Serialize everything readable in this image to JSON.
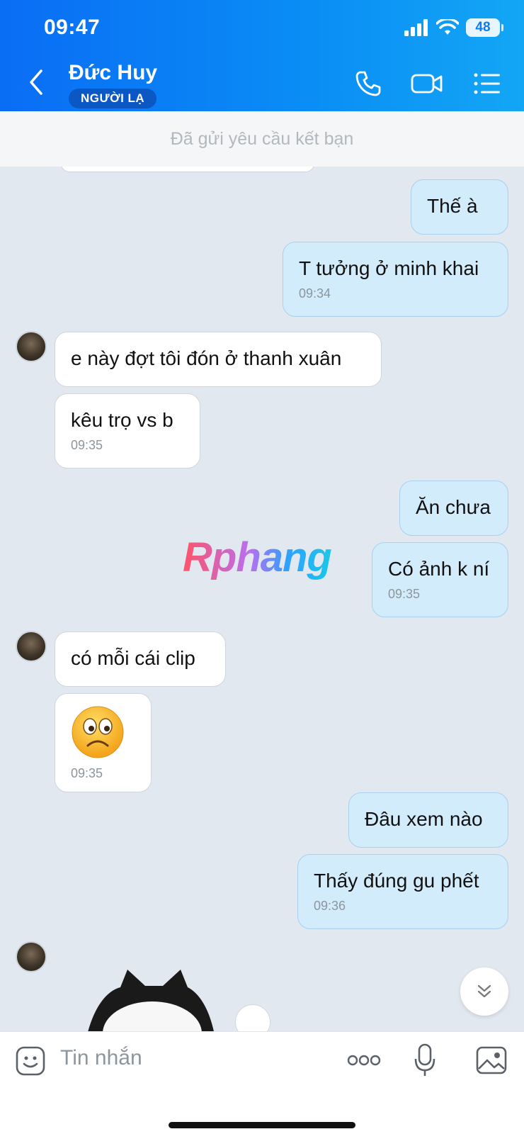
{
  "status_bar": {
    "time": "09:47",
    "battery": "48"
  },
  "header": {
    "contact_name": "Đức Huy",
    "badge": "NGƯỜI LẠ"
  },
  "friend_request": {
    "text": "Đã gửi yêu cầu kết bạn"
  },
  "messages": [
    {
      "from": "me",
      "text": "Thế à"
    },
    {
      "from": "me",
      "text": "T tưởng ở minh khai",
      "time": "09:34"
    },
    {
      "from": "them",
      "text": "e này đợt tôi đón ở thanh xuân"
    },
    {
      "from": "them",
      "text": "kêu trọ vs b",
      "time": "09:35"
    },
    {
      "from": "me",
      "text": "Ăn chưa"
    },
    {
      "from": "me",
      "text": "Có ảnh k ní",
      "time": "09:35"
    },
    {
      "from": "them",
      "text": "có mỗi cái clip"
    },
    {
      "from": "them",
      "emoji": "😟",
      "time": "09:35"
    },
    {
      "from": "me",
      "text": "Đâu xem nào"
    },
    {
      "from": "me",
      "text": "Thấy đúng gu phết",
      "time": "09:36"
    }
  ],
  "watermark": "Rphang",
  "input": {
    "placeholder": "Tin nhắn"
  },
  "colors": {
    "header_blue": "#0a78f5",
    "my_bubble": "#d3ecfc",
    "their_bubble": "#ffffff",
    "badge": "#0b57c4"
  }
}
